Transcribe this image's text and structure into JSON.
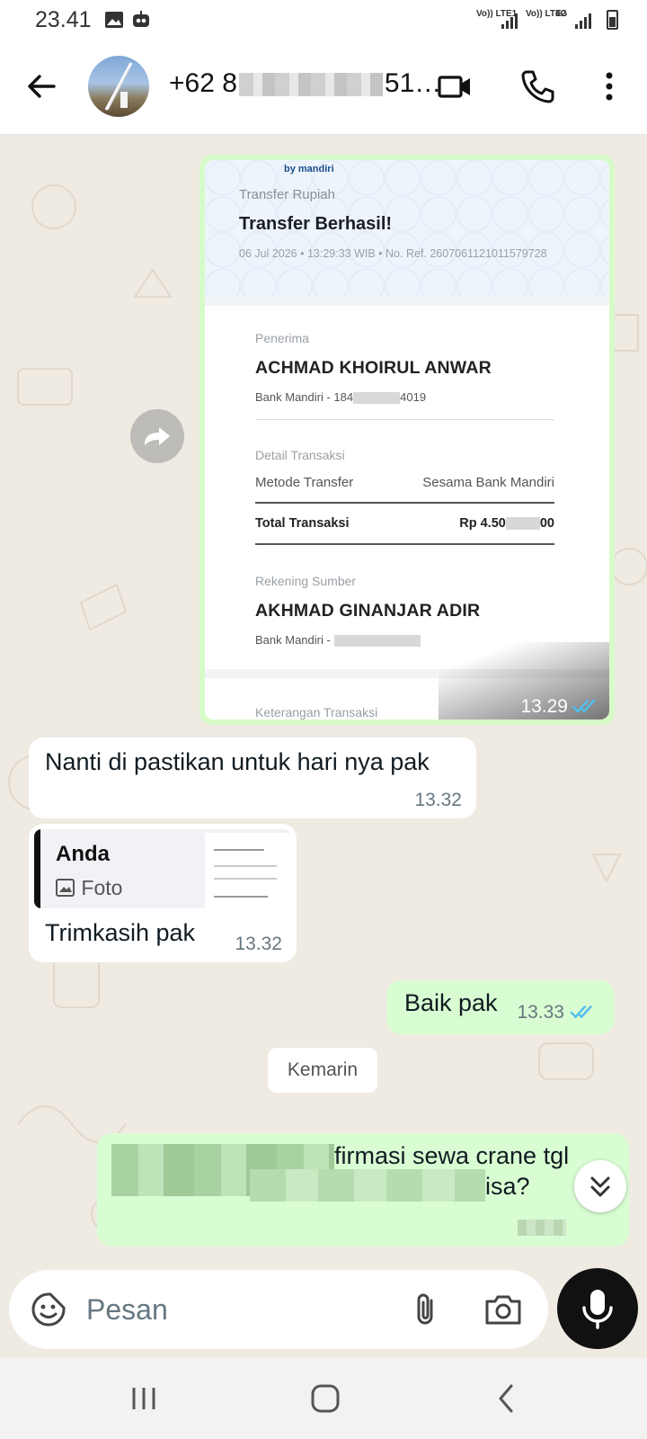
{
  "status_bar": {
    "time": "23.41",
    "sim1": "Vo)) LTE1",
    "sim2": "Vo)) LTE2",
    "net": "4G"
  },
  "header": {
    "contact_prefix": "+62 8",
    "contact_suffix": "51…",
    "icons": [
      "back-arrow-icon",
      "video-call-icon",
      "phone-icon",
      "more-vert-icon"
    ]
  },
  "receipt": {
    "logo_text": "by mandiri",
    "subtitle": "Transfer Rupiah",
    "title": "Transfer Berhasil!",
    "meta": "06 Jul 2026 • 13:29:33 WIB • No. Ref. 2607061121011579728",
    "recipient_label": "Penerima",
    "recipient_name": "ACHMAD KHOIRUL ANWAR",
    "recipient_bank_prefix": "Bank Mandiri - 184",
    "recipient_bank_suffix": "4019",
    "detail_label": "Detail Transaksi",
    "method_label": "Metode Transfer",
    "method_value": "Sesama Bank Mandiri",
    "total_label": "Total Transaksi",
    "total_prefix": "Rp 4.50",
    "total_suffix": "00",
    "source_label": "Rekening Sumber",
    "source_name": "AKHMAD GINANJAR ADIR",
    "source_bank": "Bank Mandiri -",
    "notes_label": "Keterangan Transaksi",
    "time": "13.29"
  },
  "messages": {
    "m1_text": "Nanti di pastikan untuk hari nya pak",
    "m1_time": "13.32",
    "m2_reply_who": "Anda",
    "m2_reply_type": "Foto",
    "m2_text": "Trimkasih pak",
    "m2_time": "13.32",
    "m3_text": "Baik pak",
    "m3_time": "13.33",
    "date_chip": "Kemarin",
    "m4_line1": "firmasi sewa crane tgl",
    "m4_line2": "isa?"
  },
  "composer": {
    "placeholder": "Pesan"
  },
  "colors": {
    "outgoing_bubble": "#d9fdd3",
    "incoming_bubble": "#ffffff",
    "read_ticks": "#53bdeb",
    "wallpaper": "#efeae2"
  }
}
